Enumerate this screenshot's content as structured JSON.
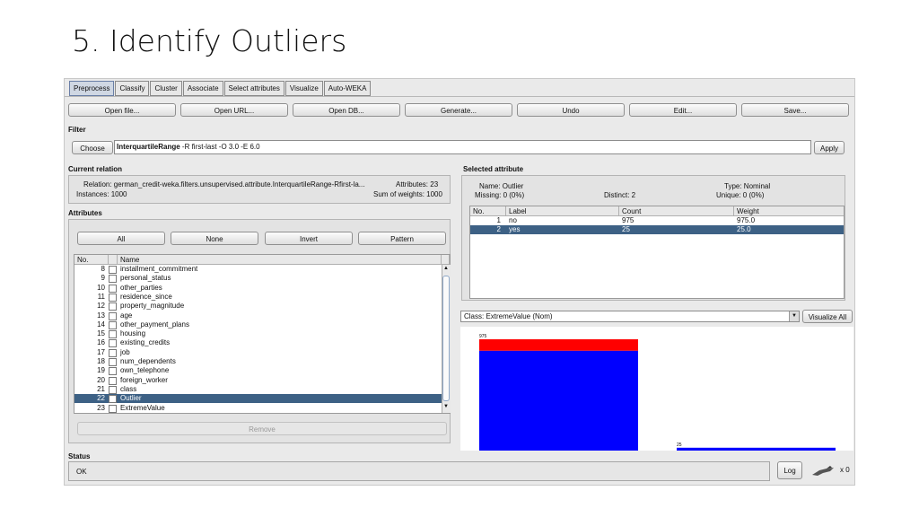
{
  "slide": {
    "title": "5. Identify Outliers"
  },
  "tabs": [
    "Preprocess",
    "Classify",
    "Cluster",
    "Associate",
    "Select attributes",
    "Visualize",
    "Auto-WEKA"
  ],
  "toolbar": [
    "Open file...",
    "Open URL...",
    "Open DB...",
    "Generate...",
    "Undo",
    "Edit...",
    "Save..."
  ],
  "filter": {
    "label": "Filter",
    "choose": "Choose",
    "name": "InterquartileRange",
    "args": " -R first-last -O 3.0 -E 6.0",
    "apply": "Apply"
  },
  "relation": {
    "label": "Current relation",
    "relation": "Relation: german_credit-weka.filters.unsupervised.attribute.InterquartileRange-Rfirst-la...",
    "attributes": "Attributes: 23",
    "instances": "Instances: 1000",
    "sumweights": "Sum of weights: 1000"
  },
  "attributes": {
    "label": "Attributes",
    "buttons": [
      "All",
      "None",
      "Invert",
      "Pattern"
    ],
    "col_no": "No.",
    "col_name": "Name",
    "rows": [
      {
        "no": "8",
        "name": "installment_commitment"
      },
      {
        "no": "9",
        "name": "personal_status"
      },
      {
        "no": "10",
        "name": "other_parties"
      },
      {
        "no": "11",
        "name": "residence_since"
      },
      {
        "no": "12",
        "name": "property_magnitude"
      },
      {
        "no": "13",
        "name": "age"
      },
      {
        "no": "14",
        "name": "other_payment_plans"
      },
      {
        "no": "15",
        "name": "housing"
      },
      {
        "no": "16",
        "name": "existing_credits"
      },
      {
        "no": "17",
        "name": "job"
      },
      {
        "no": "18",
        "name": "num_dependents"
      },
      {
        "no": "19",
        "name": "own_telephone"
      },
      {
        "no": "20",
        "name": "foreign_worker"
      },
      {
        "no": "21",
        "name": "class"
      },
      {
        "no": "22",
        "name": "Outlier"
      },
      {
        "no": "23",
        "name": "ExtremeValue"
      }
    ],
    "remove": "Remove"
  },
  "selected": {
    "label": "Selected attribute",
    "name": "Name: Outlier",
    "type": "Type: Nominal",
    "missing": "Missing: 0 (0%)",
    "distinct": "Distinct: 2",
    "unique": "Unique: 0 (0%)",
    "cols": [
      "No.",
      "Label",
      "Count",
      "Weight"
    ],
    "rows": [
      {
        "no": "1",
        "label": "no",
        "count": "975",
        "weight": "975.0"
      },
      {
        "no": "2",
        "label": "yes",
        "count": "25",
        "weight": "25.0"
      }
    ]
  },
  "classbox": {
    "value": "Class: ExtremeValue (Nom)",
    "visualize": "Visualize All"
  },
  "histogram": {
    "bars": [
      {
        "label": "975",
        "total": 975,
        "red": 100
      },
      {
        "label": "25",
        "total": 25,
        "red": 0
      }
    ],
    "colors": {
      "red": "#ff0000",
      "blue": "#0000ff"
    }
  },
  "status": {
    "label": "Status",
    "text": "OK",
    "log": "Log",
    "count": "x 0"
  }
}
